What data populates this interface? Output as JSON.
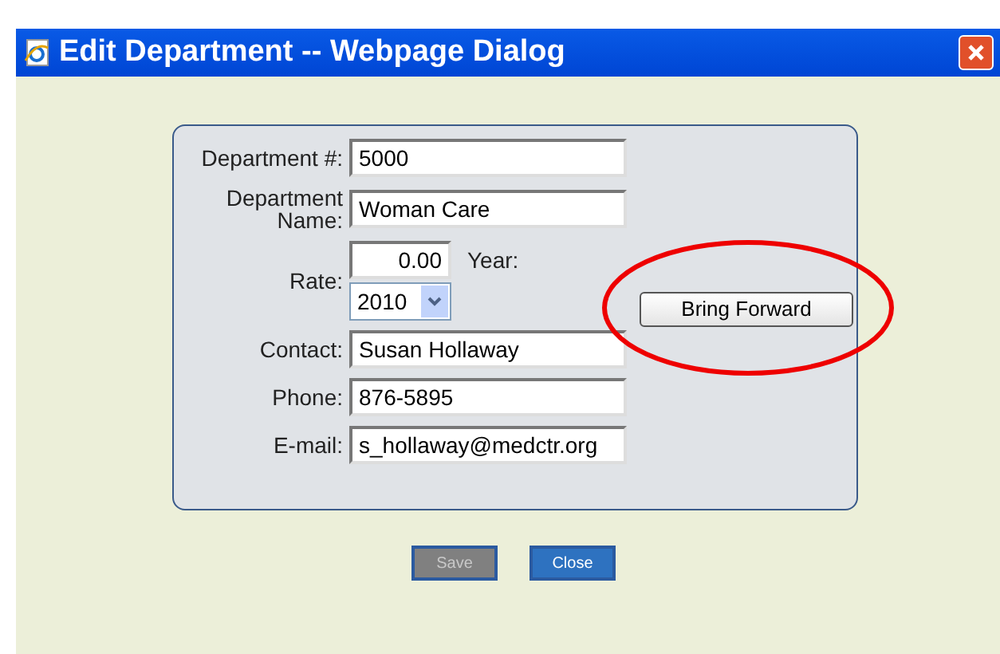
{
  "window": {
    "title": "Edit Department -- Webpage Dialog"
  },
  "form": {
    "fields": [
      {
        "label": "Department #:",
        "kind": "text",
        "value": "5000"
      },
      {
        "label": "Department Name:",
        "kind": "text",
        "value": "Woman Care"
      },
      {
        "label": "Rate:",
        "kind": "rate",
        "value": "0.00",
        "year_label": "Year:",
        "year": "2010"
      },
      {
        "label": "Contact:",
        "kind": "text",
        "value": "Susan Hollaway"
      },
      {
        "label": "Phone:",
        "kind": "text",
        "value": "876-5895"
      },
      {
        "label": "E-mail:",
        "kind": "text",
        "value": "s_hollaway@medctr.org"
      }
    ],
    "side_button": {
      "label": "Bring Forward",
      "highlighted": true
    }
  },
  "buttons": [
    {
      "label": "Save",
      "disabled": true
    },
    {
      "label": "Close",
      "disabled": false
    }
  ]
}
